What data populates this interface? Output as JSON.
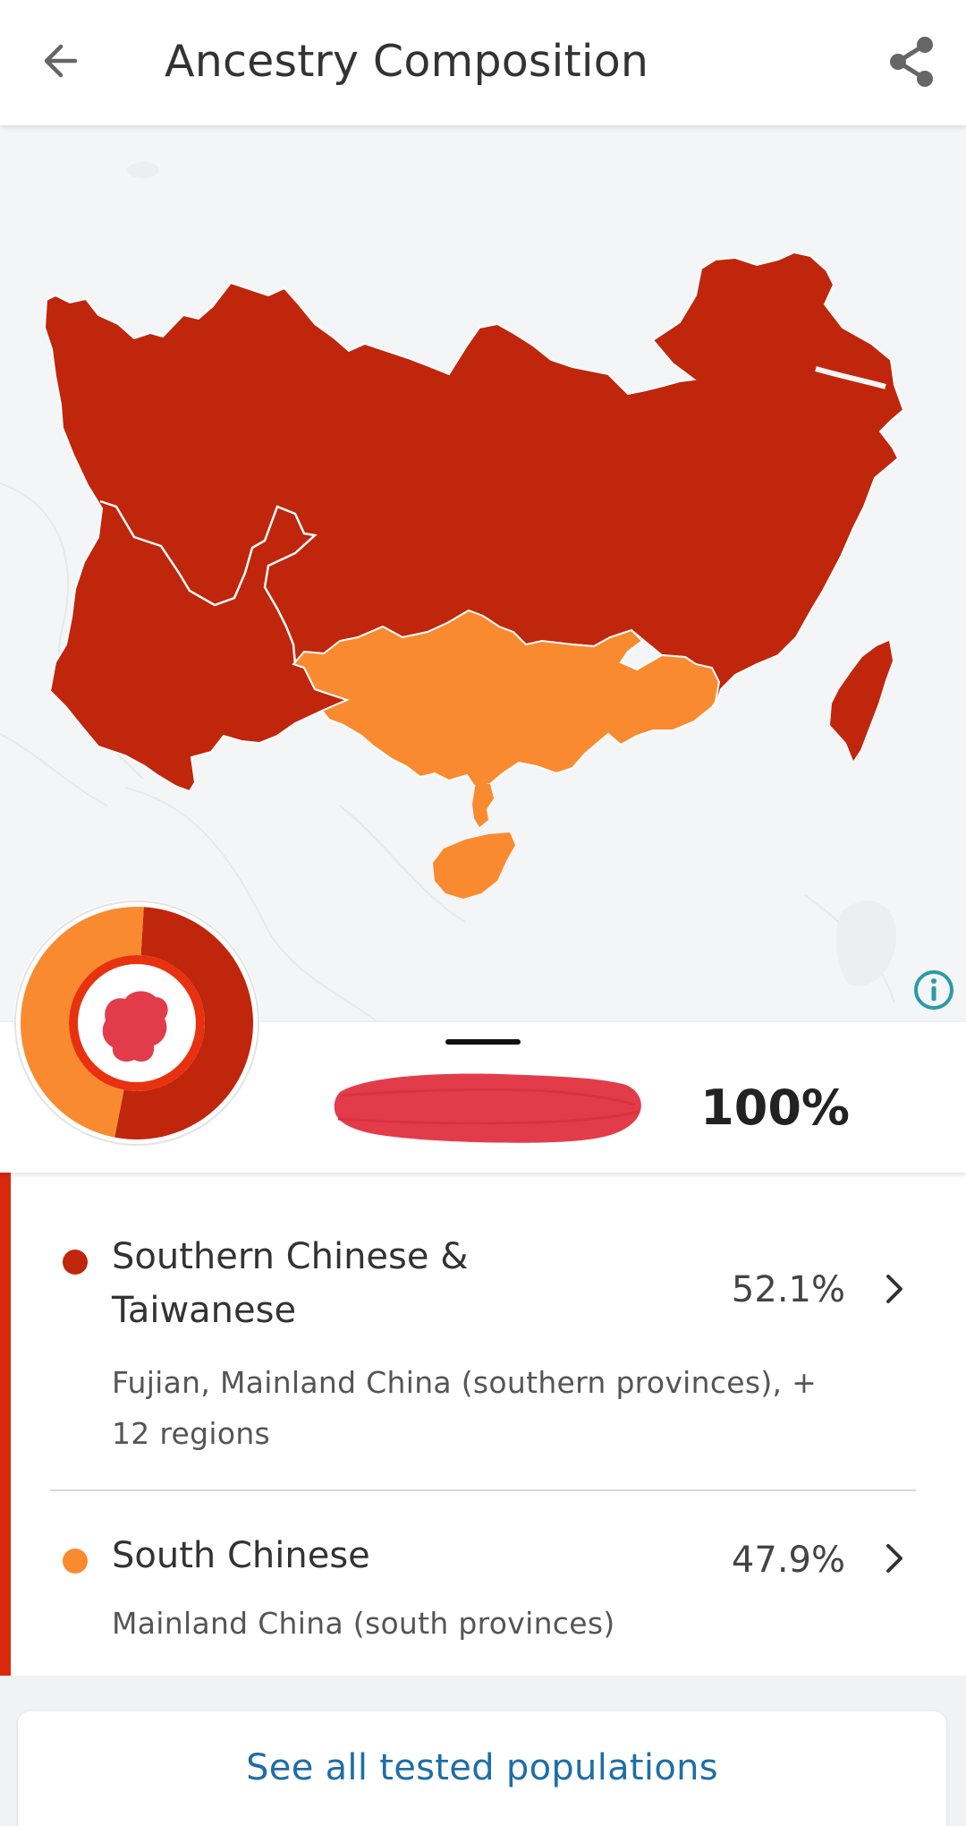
{
  "header": {
    "title": "Ancestry Composition",
    "back_icon": "arrow-left-icon",
    "share_icon": "share-icon"
  },
  "colors": {
    "southern_chinese_taiwanese": "#c0260c",
    "south_chinese": "#f98a30",
    "accent_bar": "#d8290c",
    "link": "#1e6ea8",
    "info": "#2a9aa8",
    "redaction": "#e23c4b"
  },
  "summary": {
    "percent": "100%"
  },
  "donut": {
    "segments": [
      {
        "name": "Southern Chinese & Taiwanese",
        "value": 52.1
      },
      {
        "name": "South Chinese",
        "value": 47.9
      }
    ]
  },
  "populations": [
    {
      "name_line1": "Southern Chinese &",
      "name_line2": "Taiwanese",
      "percent": "52.1%",
      "desc_line1": "Fujian, Mainland China (southern provinces), +",
      "desc_line2": "12 regions"
    },
    {
      "name_line1": "South Chinese",
      "percent": "47.9%",
      "desc_line1": "Mainland China (south provinces)"
    }
  ],
  "footer": {
    "see_all_label": "See all tested populations"
  }
}
